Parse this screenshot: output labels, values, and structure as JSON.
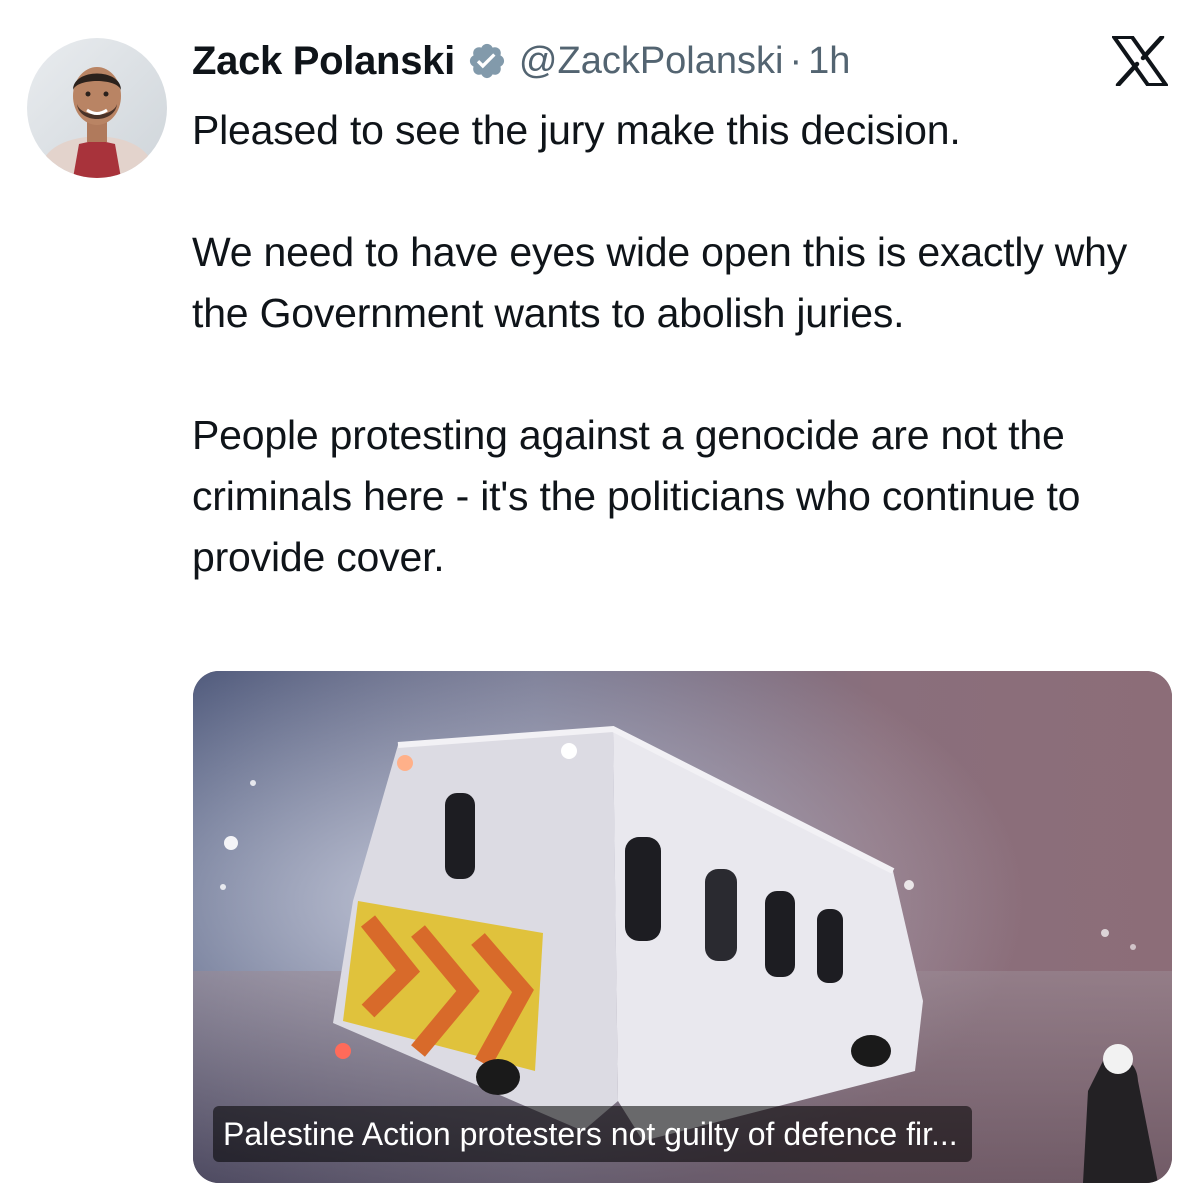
{
  "tweet": {
    "author": {
      "display_name": "Zack Polanski",
      "handle": "@ZackPolanski",
      "verified": true
    },
    "separator": "·",
    "time": "1h",
    "paragraphs": [
      "Pleased to see the jury make this decision.",
      "We need to have eyes wide open this is exactly why the Government wants to abolish juries.",
      "People protesting against a genocide are not the criminals here - it's the politicians who continue to provide cover."
    ],
    "media": {
      "caption": "Palestine Action protesters not guilty of defence fir..."
    }
  },
  "icons": {
    "verified": "verified-badge-icon",
    "platform": "x-logo-icon"
  },
  "colors": {
    "text": "#0f1419",
    "secondary": "#536471",
    "verified": "#829aab"
  }
}
